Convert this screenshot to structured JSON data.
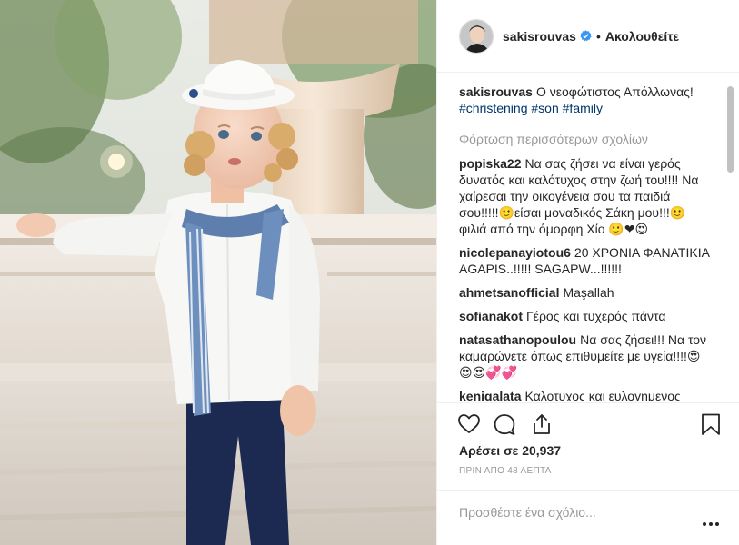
{
  "post": {
    "author": "sakisrouvas",
    "follow_status": "Ακολουθείτε",
    "separator": "•",
    "caption_text": "Ο νεοφώτιστος Απόλλωνας!",
    "caption_tags": [
      "#christening",
      "#son",
      "#family"
    ],
    "load_more": "Φόρτωση περισσότερων σχολίων"
  },
  "comments": [
    {
      "user": "popiska22",
      "text": "Να σας ζήσει να είναι γερός δυνατός και καλότυχος στην ζωή του!!!! Να χαίρεσαι την οικογένεια σου τα παιδιά σου!!!!!🙂είσαι μοναδικός Σάκη μου!!!🙂 φιλιά από την όμορφη Χίο 🙂❤😍"
    },
    {
      "user": "nicolepanayiotou6",
      "text": "20 ΧΡΟΝΙΑ ΦΑΝΑΤΙΚΙΑ AGAPIS..!!!!! SAGAPW...!!!!!!"
    },
    {
      "user": "ahmetsanofficial",
      "text": "Maşallah"
    },
    {
      "user": "sofianakot",
      "text": "Γέρος και τυχερός πάντα"
    },
    {
      "user": "natasathanopoulou",
      "text": "Να σας ζήσει!!! Να τον καμαρώνετε όπως επιθυμείτε με υγεία!!!!😍😍😍💞💞"
    },
    {
      "user": "kenigalata",
      "text": "Καλοτυχος και ευλογημενος στην ζωη του να τον χαιρεστε !!!"
    }
  ],
  "engagement": {
    "likes": "Αρέσει σε 20,937",
    "time_ago": "ΠΡΙΝ ΑΠΟ 48 ΛΕΠΤΑ"
  },
  "add_comment": {
    "placeholder": "Προσθέστε ένα σχόλιο..."
  },
  "icons": {
    "like": "heart-icon",
    "comment": "comment-icon",
    "share": "share-icon",
    "save": "bookmark-icon",
    "verified": "verified-badge-icon",
    "more": "more-options-icon"
  },
  "colors": {
    "verified": "#3897f0",
    "tag": "#003569",
    "muted": "#999999",
    "text": "#262626"
  }
}
